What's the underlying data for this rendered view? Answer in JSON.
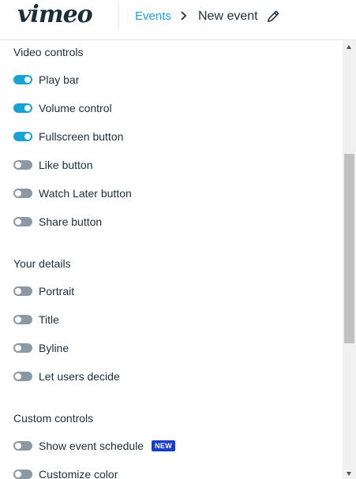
{
  "header": {
    "logo": "vimeo",
    "breadcrumb_link": "Events",
    "breadcrumb_current": "New event",
    "icons": {
      "chevron": "chevron-right-icon",
      "edit": "pencil-icon"
    }
  },
  "sections": [
    {
      "title": "Video controls",
      "items": [
        {
          "label": "Play bar",
          "on": true
        },
        {
          "label": "Volume control",
          "on": true
        },
        {
          "label": "Fullscreen button",
          "on": true
        },
        {
          "label": "Like button",
          "on": false
        },
        {
          "label": "Watch Later button",
          "on": false
        },
        {
          "label": "Share button",
          "on": false
        }
      ]
    },
    {
      "title": "Your details",
      "items": [
        {
          "label": "Portrait",
          "on": false
        },
        {
          "label": "Title",
          "on": false
        },
        {
          "label": "Byline",
          "on": false
        },
        {
          "label": "Let users decide",
          "on": false
        }
      ]
    },
    {
      "title": "Custom controls",
      "items": [
        {
          "label": "Show event schedule",
          "on": false,
          "badge": "NEW"
        },
        {
          "label": "Customize color",
          "on": false
        }
      ]
    }
  ],
  "colors": {
    "accent": "#17a3d4",
    "toggle_off": "#8a99a3",
    "badge": "#1a3ec8",
    "text": "#1a2e3b"
  }
}
